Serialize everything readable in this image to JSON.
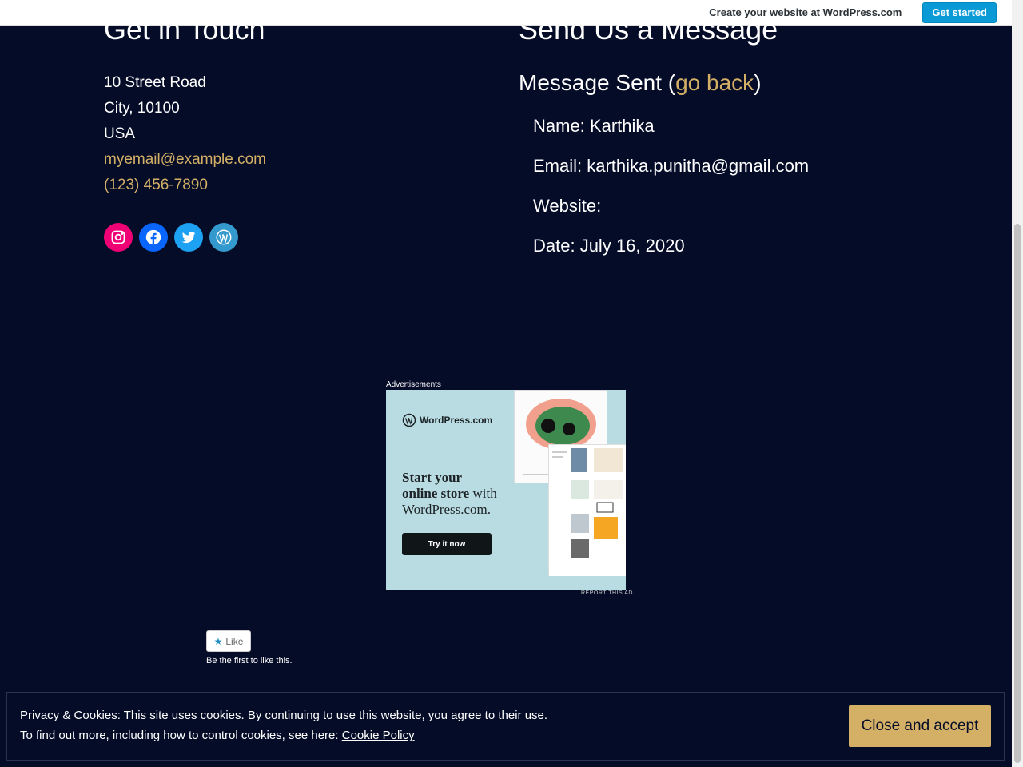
{
  "wpbar": {
    "text": "Create your website at WordPress.com",
    "button_label": "Get started"
  },
  "contact": {
    "heading": "Get in Touch",
    "address": [
      "10 Street Road",
      "City, 10100",
      "USA"
    ],
    "email": "myemail@example.com",
    "phone": "(123) 456-7890",
    "social": [
      {
        "name": "instagram-icon",
        "color": "#f00075"
      },
      {
        "name": "facebook-icon",
        "color": "#0866ff"
      },
      {
        "name": "twitter-icon",
        "color": "#1da1f2"
      },
      {
        "name": "wordpress-icon",
        "color": "#3499cd"
      }
    ]
  },
  "message": {
    "heading": "Send Us a Message",
    "sent_prefix": "Message Sent (",
    "go_back": "go back",
    "sent_suffix": ")",
    "fields": {
      "name": "Name: Karthika",
      "email": "Email: karthika.punitha@gmail.com",
      "website": "Website:",
      "date": "Date: July 16, 2020"
    }
  },
  "ad": {
    "label": "Advertisements",
    "brand": "WordPress.com",
    "headline_1": "Start your",
    "headline_2": "online store",
    "headline_3": " with",
    "headline_4": "WordPress.com.",
    "cta": "Try it now",
    "report": "REPORT THIS AD"
  },
  "like": {
    "button_label": "Like",
    "note": "Be the first to like this."
  },
  "cookie": {
    "line1": "Privacy & Cookies: This site uses cookies. By continuing to use this website, you agree to their use.",
    "line2_prefix": "To find out more, including how to control cookies, see here: ",
    "policy_link": "Cookie Policy",
    "button_label": "Close and accept"
  },
  "colors": {
    "background": "#050c28",
    "accent": "#d4b067",
    "wp_blue": "#0a9ad6"
  }
}
